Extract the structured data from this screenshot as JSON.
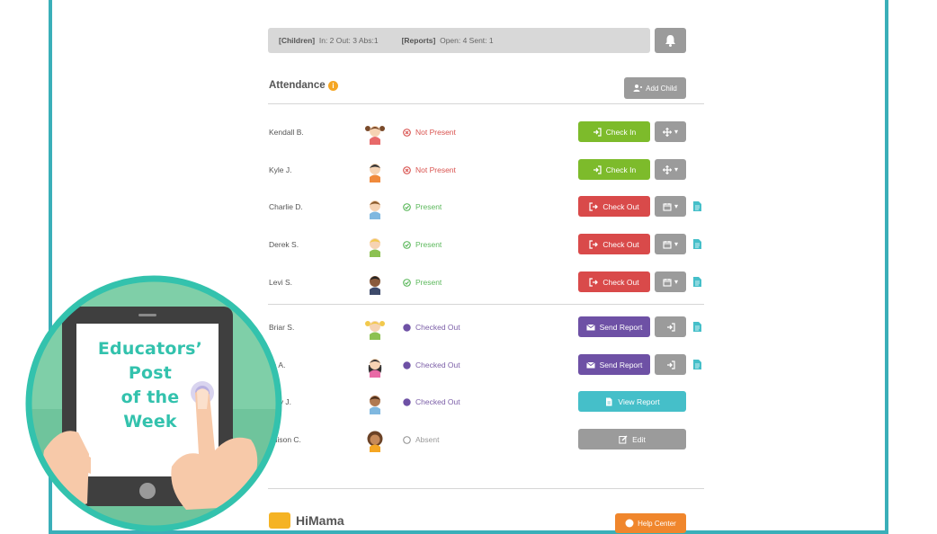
{
  "summary": {
    "children_label": "[Children]",
    "children_stats": "In: 2  Out: 3  Abs:1",
    "reports_label": "[Reports]",
    "reports_stats": "Open: 4   Sent: 1"
  },
  "attendance": {
    "title": "Attendance",
    "add_child_label": "Add Child",
    "rows": [
      {
        "name": "Kendall B.",
        "status": "Not Present",
        "action": "Check In",
        "avatar": "girl-pigtails-avatar"
      },
      {
        "name": "Kyle J.",
        "status": "Not Present",
        "action": "Check In",
        "avatar": "boy-dark-hair-avatar"
      },
      {
        "name": "Charlie D.",
        "status": "Present",
        "action": "Check Out",
        "avatar": "boy-brown-hair-avatar"
      },
      {
        "name": "Derek S.",
        "status": "Present",
        "action": "Check Out",
        "avatar": "boy-blond-hair-avatar"
      },
      {
        "name": "Levi S.",
        "status": "Present",
        "action": "Check Out",
        "avatar": "boy-dark-skin-avatar"
      },
      {
        "name": "Briar S.",
        "status": "Checked Out",
        "action": "Send Report",
        "avatar": "girl-blond-pigtails-avatar"
      },
      {
        "name": "lla A.",
        "status": "Checked Out",
        "action": "Send Report",
        "avatar": "girl-dark-hair-avatar"
      },
      {
        "name": "othy J.",
        "status": "Checked Out",
        "action": "View Report",
        "avatar": "boy-brown-skin-avatar"
      },
      {
        "name": "ddison C.",
        "status": "Absent",
        "action": "Edit",
        "avatar": "girl-curly-hair-avatar"
      }
    ]
  },
  "footer": {
    "logo_text": "HiMama",
    "help_label": "Help Center"
  },
  "badge": {
    "line1": "Educators’",
    "line2": "Post",
    "line3": "of the",
    "line4": "Week"
  },
  "colors": {
    "frame": "#3aafb9",
    "check_in": "#7dbb2b",
    "check_out": "#d94a4a",
    "send_report": "#6e51a5",
    "view_report": "#45bfc9",
    "edit": "#9b9b9b",
    "badge_ring": "#33c2ad",
    "badge_text": "#33c2ad"
  }
}
